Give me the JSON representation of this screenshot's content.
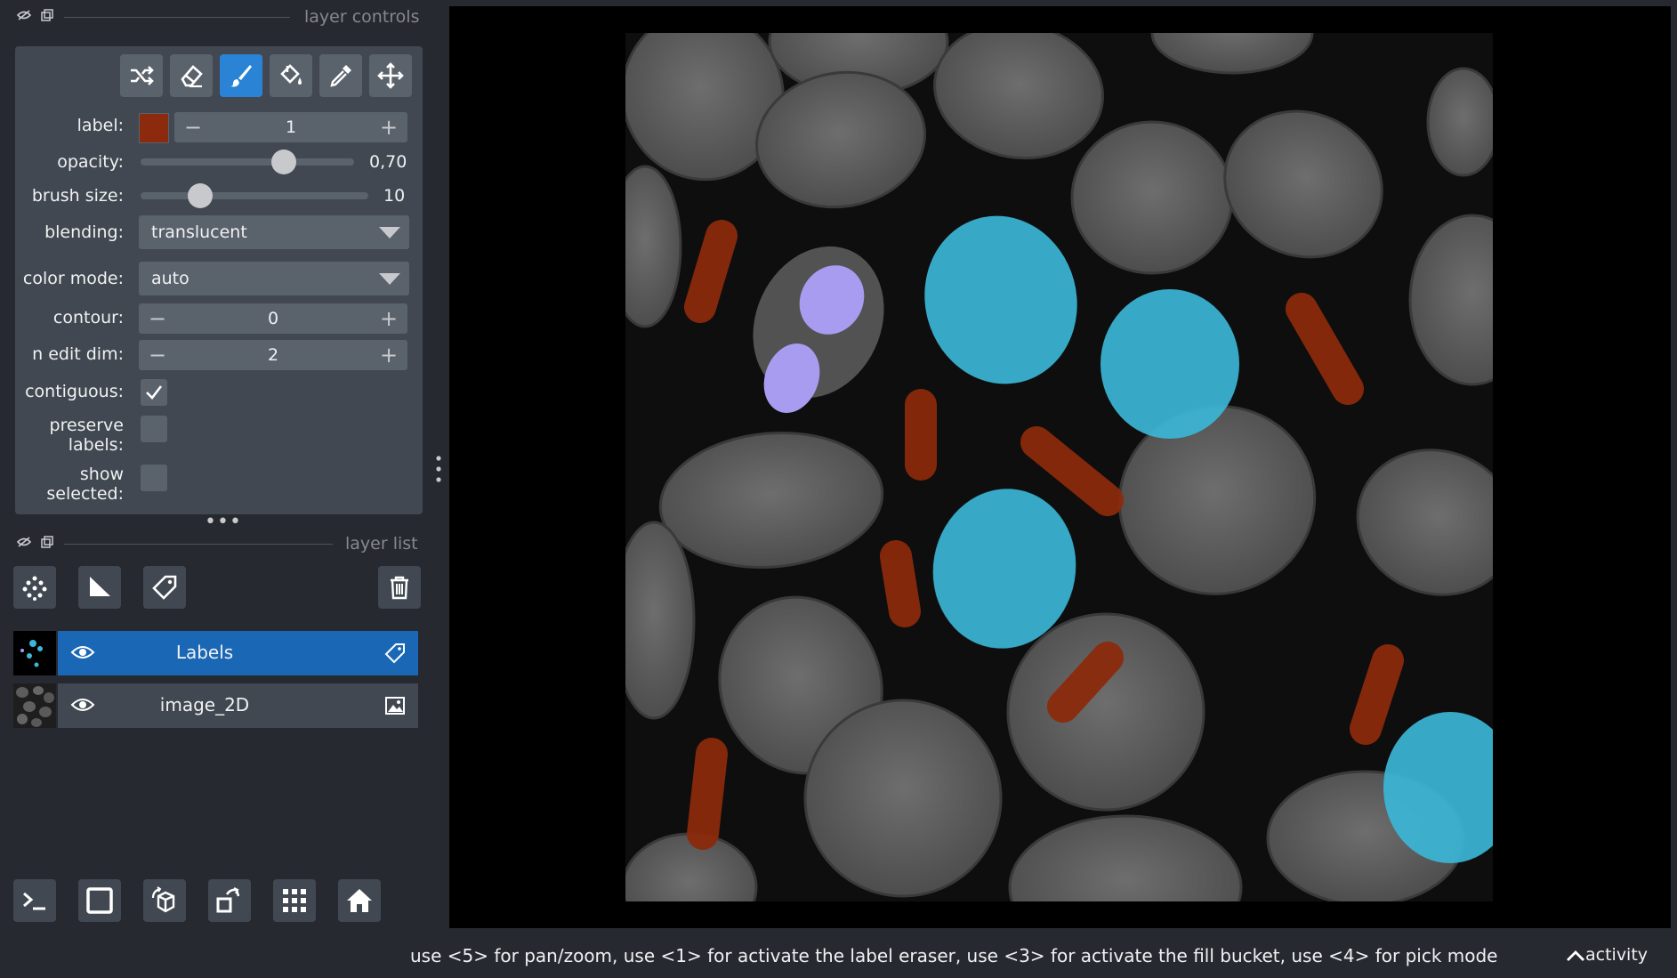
{
  "colors": {
    "background": "#262930",
    "panel": "#414851",
    "control": "#5a626c",
    "accent": "#2a83d4",
    "selected_layer": "#1a68b5",
    "label_color": "#8b2a0c",
    "nucleus_gray": "#5c5c5c",
    "cyan_label": "#3bb8d8",
    "lavender_label": "#a89cf0",
    "rust_label": "#8b2a0c"
  },
  "layer_controls": {
    "header": "layer controls",
    "tools": [
      {
        "icon": "shuffle-icon",
        "active": false
      },
      {
        "icon": "eraser-icon",
        "active": false
      },
      {
        "icon": "paintbrush-icon",
        "active": true
      },
      {
        "icon": "fill-bucket-icon",
        "active": false
      },
      {
        "icon": "eyedropper-icon",
        "active": false
      },
      {
        "icon": "move-icon",
        "active": false
      }
    ],
    "label": {
      "text": "label:",
      "value": "1"
    },
    "opacity": {
      "text": "opacity:",
      "value": "0,70",
      "fraction": 0.7
    },
    "brush_size": {
      "text": "brush size:",
      "value": "10",
      "fraction": 0.27
    },
    "blending": {
      "text": "blending:",
      "value": "translucent"
    },
    "color_mode": {
      "text": "color mode:",
      "value": "auto"
    },
    "contour": {
      "text": "contour:",
      "value": "0"
    },
    "n_edit_dim": {
      "text": "n edit dim:",
      "value": "2"
    },
    "contiguous": {
      "text": "contiguous:",
      "checked": true
    },
    "preserve_labels": {
      "text_line1": "preserve",
      "text_line2": "labels:",
      "checked": false
    },
    "show_selected": {
      "text_line1": "show",
      "text_line2": "selected:",
      "checked": false
    }
  },
  "layer_list": {
    "header": "layer list",
    "buttons": [
      "new-points-icon",
      "new-shapes-icon",
      "new-labels-icon",
      "delete-layer-icon"
    ],
    "layers": [
      {
        "name": "Labels",
        "selected": true,
        "visible": true,
        "type_icon": "label-tag-icon"
      },
      {
        "name": "image_2D",
        "selected": false,
        "visible": true,
        "type_icon": "image-icon"
      }
    ]
  },
  "bottom_buttons": [
    "console-icon",
    "ndisplay-square-icon",
    "3d-cube-icon",
    "rotate-icon",
    "grid-icon",
    "home-icon"
  ],
  "status": {
    "message": "use <5> for pan/zoom, use <1> for activate the label eraser, use <3> for activate the fill bucket, use <4> for pick mode",
    "activity": "activity"
  }
}
